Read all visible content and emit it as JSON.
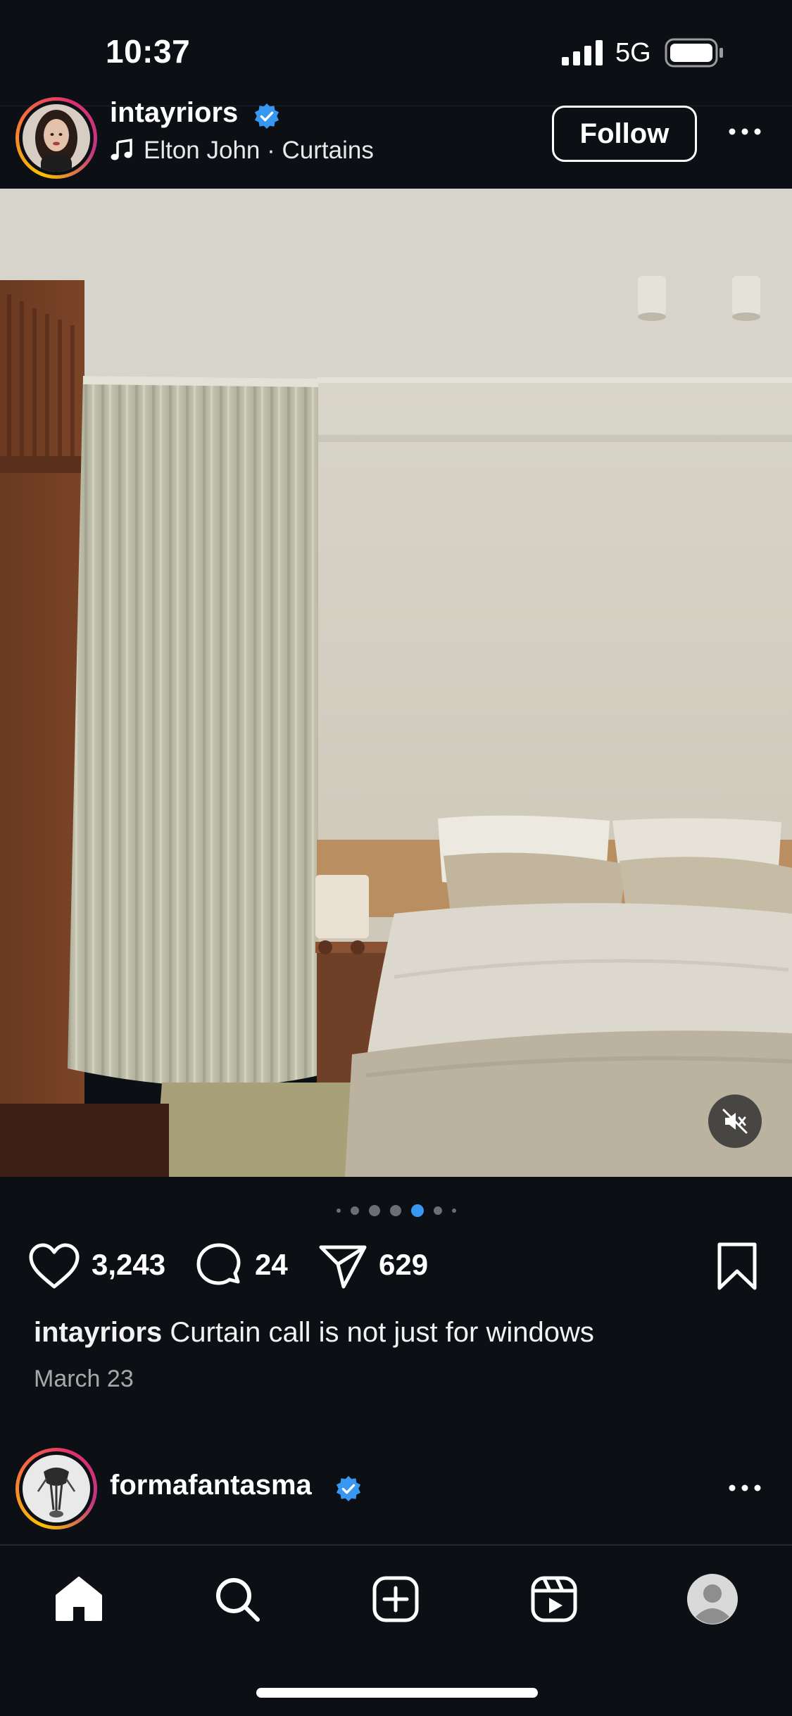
{
  "status_bar": {
    "time": "10:37",
    "network": "5G",
    "signal_icon": "signal-bars-icon",
    "battery_icon": "battery-icon"
  },
  "post": {
    "username": "intayriors",
    "verified": true,
    "music": "Elton John · Curtains",
    "follow_label": "Follow",
    "more_icon": "more-horizontal-icon",
    "carousel": {
      "count": 7,
      "active_index": 4
    },
    "likes": "3,243",
    "comments": "24",
    "shares": "629",
    "caption_user": "intayriors",
    "caption_text": " Curtain call is not just for windows",
    "date": "March 23",
    "mute_icon": "speaker-muted-icon"
  },
  "next_post": {
    "username": "formafantasma",
    "verified": true,
    "more_icon": "more-horizontal-icon"
  },
  "tab_bar": {
    "items": [
      "home-icon",
      "search-icon",
      "create-icon",
      "reels-icon",
      "profile-icon"
    ],
    "active": "home-icon"
  },
  "colors": {
    "background": "#0c1014",
    "verified_blue": "#3897f0",
    "carousel_active": "#3897f0",
    "text": "#ffffff",
    "muted_text": "#a8a8a8"
  }
}
